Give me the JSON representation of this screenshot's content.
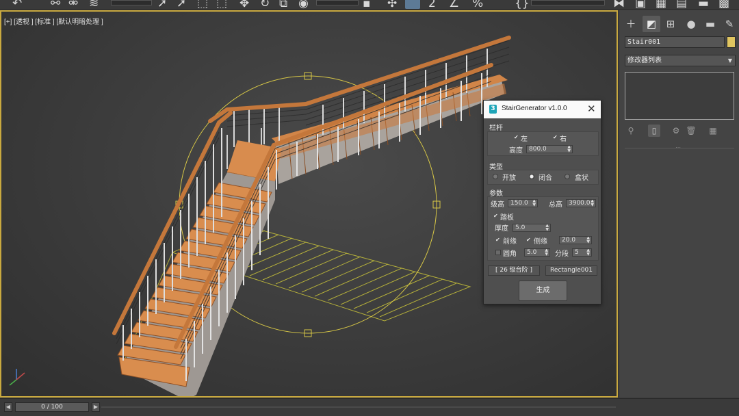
{
  "viewport": {
    "label": "[+] [透视 ] [标准 ] [默认明暗处理 ]"
  },
  "command_panel": {
    "tabs": [
      "create-icon",
      "modify-icon",
      "hierarchy-icon",
      "motion-icon",
      "display-icon",
      "utilities-icon"
    ],
    "object_name": "Stair001",
    "object_color": "#e0c560",
    "modifier_list": "修改器列表"
  },
  "timebar": {
    "frame_text": "0 / 100"
  },
  "dialog": {
    "title": "StairGenerator v1.0.0",
    "railing": {
      "section": "栏杆",
      "left_label": "左",
      "left_checked": true,
      "right_label": "右",
      "right_checked": true,
      "height_label": "高度",
      "height_value": "800.0"
    },
    "type": {
      "section": "类型",
      "options": [
        "开放",
        "闭合",
        "盒状"
      ],
      "selected": "闭合"
    },
    "params": {
      "section": "参数",
      "step_height_label": "级高",
      "step_height_value": "150.0",
      "total_height_label": "总高",
      "total_height_value": "3900.0",
      "tread_label": "踏板",
      "tread_checked": true,
      "thickness_label": "厚度",
      "thickness_value": "5.0",
      "front_edge_label": "前缘",
      "front_edge_checked": true,
      "side_edge_label": "侧缘",
      "side_edge_checked": true,
      "edge_value": "20.0",
      "round_label": "圆角",
      "round_checked": false,
      "round_value": "5.0",
      "segments_label": "分段",
      "segments_value": "5"
    },
    "steps_button": "[ 26 级台阶 ]",
    "pick_button": "Rectangle001",
    "generate_button": "生成"
  }
}
